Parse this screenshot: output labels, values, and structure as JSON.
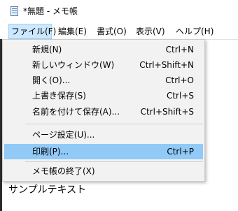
{
  "window": {
    "title": "*無題 - メモ帳",
    "icon": "notepad-icon"
  },
  "menubar": {
    "items": [
      {
        "label": "ファイル(F)"
      },
      {
        "label": "編集(E)"
      },
      {
        "label": "書式(O)"
      },
      {
        "label": "表示(V)"
      },
      {
        "label": "ヘルプ(H)"
      }
    ],
    "active_index": 0
  },
  "file_menu": {
    "items": [
      {
        "label": "新規(N)",
        "shortcut": "Ctrl+N"
      },
      {
        "label": "新しいウィンドウ(W)",
        "shortcut": "Ctrl+Shift+N"
      },
      {
        "label": "開く(O)...",
        "shortcut": "Ctrl+O"
      },
      {
        "label": "上書き保存(S)",
        "shortcut": "Ctrl+S"
      },
      {
        "label": "名前を付けて保存(A)...",
        "shortcut": "Ctrl+Shift+S"
      },
      {
        "label": "ページ設定(U)...",
        "shortcut": ""
      },
      {
        "label": "印刷(P)...",
        "shortcut": "Ctrl+P"
      },
      {
        "label": "メモ帳の終了(X)",
        "shortcut": ""
      }
    ],
    "highlighted_index": 6
  },
  "editor": {
    "text": "サンプルテキスト"
  },
  "colors": {
    "menu_active_bg": "#cce8ff",
    "item_highlight_bg": "#91c9f7",
    "menu_bg": "#f2f2f2"
  }
}
